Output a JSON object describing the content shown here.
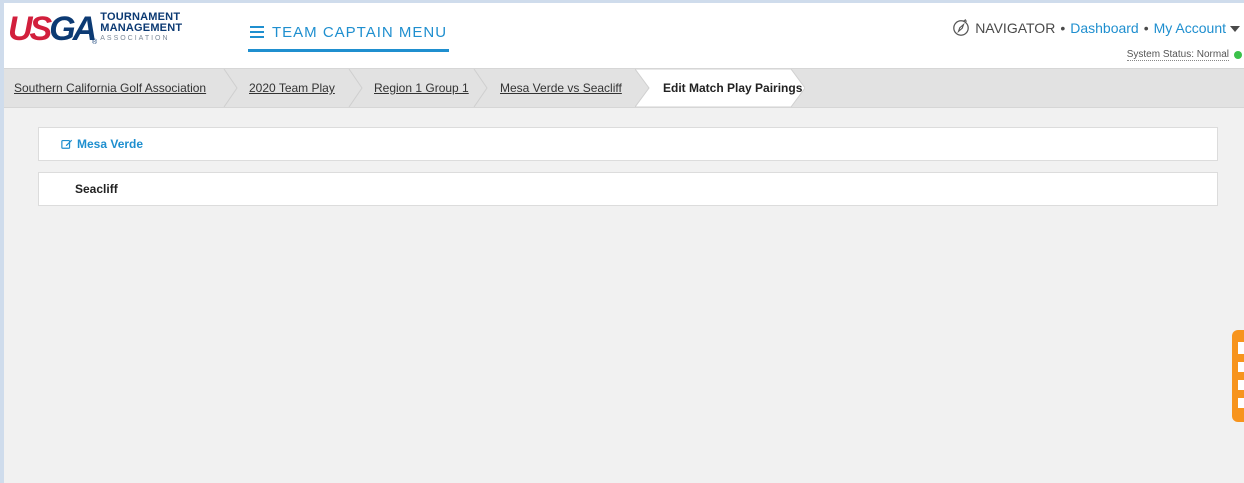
{
  "header": {
    "logo": {
      "mark_us": "US",
      "mark_ga": "GA",
      "line1": "TOURNAMENT",
      "line2": "MANAGEMENT",
      "line3": "ASSOCIATION",
      "registered": "®"
    },
    "menu_label": "TEAM CAPTAIN MENU",
    "nav": {
      "navigator": "NAVIGATOR",
      "separator": "•",
      "dashboard": "Dashboard",
      "my_account": "My Account"
    },
    "status_text": "System Status: Normal",
    "status_color": "#3bc14a"
  },
  "breadcrumb": [
    "Southern California Golf Association",
    "2020 Team Play",
    "Region 1 Group 1",
    "Mesa Verde vs Seacliff",
    "Edit Match Play Pairings"
  ],
  "teams": [
    {
      "name": "Mesa Verde",
      "icon": "edit-icon"
    },
    {
      "name": "Seacliff"
    }
  ],
  "colors": {
    "accent": "#1f8fcf",
    "brand_red": "#d21f3c",
    "brand_navy": "#0c3a73",
    "feedback_tab": "#f7941d"
  }
}
